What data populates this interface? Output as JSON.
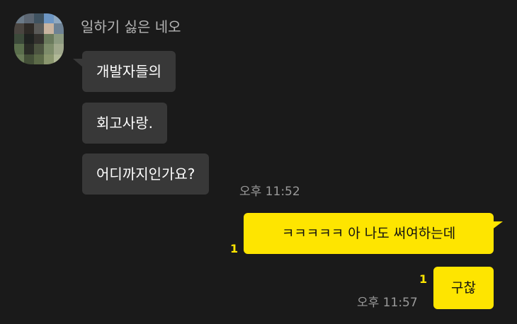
{
  "sender": {
    "name": "일하기 싫은 네오",
    "avatar_colors": [
      "#6b7a88",
      "#5c6672",
      "#3f5260",
      "#6d96c4",
      "#8fa8c0",
      "#4a4540",
      "#2e2a26",
      "#5a5a58",
      "#c9b4a0",
      "#6e8294",
      "#3c4a3a",
      "#1f2220",
      "#34322e",
      "#6a7a5c",
      "#8c9a80",
      "#5a6e4c",
      "#2a2c26",
      "#4c5440",
      "#7d8c6a",
      "#a0a88c",
      "#6a7c58",
      "#445038",
      "#5c6a48",
      "#8a966e",
      "#b0b896"
    ]
  },
  "incoming": [
    {
      "text": "개발자들의"
    },
    {
      "text": "회고사랑."
    },
    {
      "text": "어디까지인가요?"
    }
  ],
  "incoming_time": "오후 11:52",
  "outgoing": [
    {
      "text": "ㅋㅋㅋㅋㅋ 아 나도 써여하는데",
      "unread": "1"
    },
    {
      "text": "구찮",
      "unread": "1",
      "time": "오후 11:57"
    }
  ],
  "colors": {
    "background": "#1a1a1a",
    "incoming_bubble": "#383838",
    "outgoing_bubble": "#fee500",
    "unread": "#fee500",
    "time": "#9a9a9a"
  }
}
